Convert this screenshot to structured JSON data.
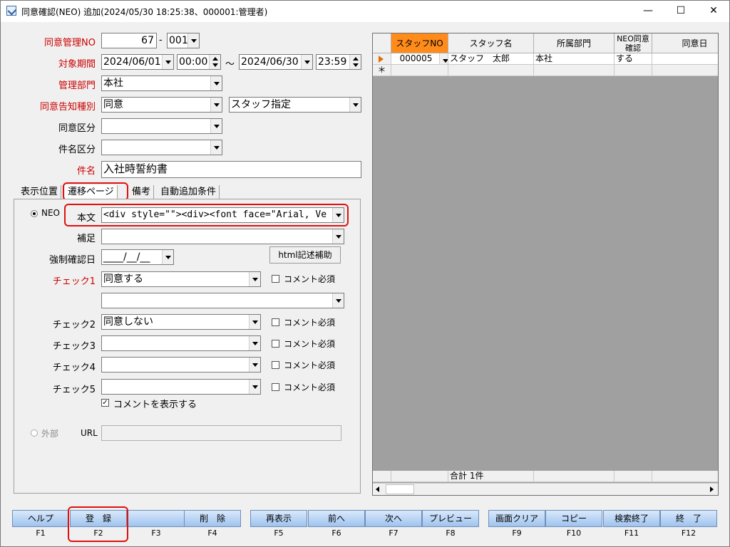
{
  "window": {
    "title": "同意確認(NEO)  追加(2024/05/30 18:25:38、000001:管理者)"
  },
  "form": {
    "consent_no": {
      "label": "同意管理NO",
      "value": "67",
      "sep": "-",
      "suffix": "001"
    },
    "period": {
      "label": "対象期間",
      "from_date": "2024/06/01",
      "from_time": "00:00",
      "tilde": "～",
      "to_date": "2024/06/30",
      "to_time": "23:59"
    },
    "department": {
      "label": "管理部門",
      "value": "本社"
    },
    "notice_type": {
      "label": "同意告知種別",
      "value": "同意",
      "value2": "スタッフ指定"
    },
    "consent_class": {
      "label": "同意区分",
      "value": ""
    },
    "subject_class": {
      "label": "件名区分",
      "value": ""
    },
    "subject": {
      "label": "件名",
      "value": "入社時誓約書"
    }
  },
  "tabs": [
    "表示位置",
    "遷移ページ",
    "備考",
    "自動追加条件"
  ],
  "panel": {
    "neo_label": "NEO",
    "body": {
      "label": "本文",
      "value": "<div style=\"\"><div><font face=\"Arial, Ve"
    },
    "supplement": {
      "label": "補足",
      "value": ""
    },
    "force_date": {
      "label": "強制確認日",
      "value": "____/__/__"
    },
    "html_helper": "html記述補助",
    "checks": [
      {
        "label": "チェック1",
        "value": "同意する",
        "comment": "コメント必須"
      },
      {
        "label": "",
        "value": ""
      },
      {
        "label": "チェック2",
        "value": "同意しない",
        "comment": "コメント必須"
      },
      {
        "label": "チェック3",
        "value": "",
        "comment": "コメント必須"
      },
      {
        "label": "チェック4",
        "value": "",
        "comment": "コメント必須"
      },
      {
        "label": "チェック5",
        "value": "",
        "comment": "コメント必須"
      }
    ],
    "show_comment": "コメントを表示する",
    "external_label": "外部",
    "url_label": "URL",
    "url_value": ""
  },
  "grid": {
    "headers": [
      "スタッフNO",
      "スタッフ名",
      "所属部門",
      "NEO同意確認",
      "同意日"
    ],
    "rows": [
      [
        "000005",
        "スタッフ　太郎",
        "本社",
        "する",
        ""
      ]
    ],
    "new_row_marker": "＊",
    "footer": "合計 1件"
  },
  "fkeys": [
    {
      "label": "ヘルプ",
      "key": "F1"
    },
    {
      "label": "登　録",
      "key": "F2"
    },
    {
      "label": "",
      "key": "F3"
    },
    {
      "label": "削　除",
      "key": "F4"
    },
    {
      "label": "再表示",
      "key": "F5"
    },
    {
      "label": "前へ",
      "key": "F6"
    },
    {
      "label": "次へ",
      "key": "F7"
    },
    {
      "label": "プレビュー",
      "key": "F8"
    },
    {
      "label": "画面クリア",
      "key": "F9"
    },
    {
      "label": "コピー",
      "key": "F10"
    },
    {
      "label": "検索終了",
      "key": "F11"
    },
    {
      "label": "終　了",
      "key": "F12"
    }
  ],
  "colors": {
    "required_label": "#cc0000",
    "highlight": "#e01010",
    "selected_header": "#ff8c1a"
  }
}
